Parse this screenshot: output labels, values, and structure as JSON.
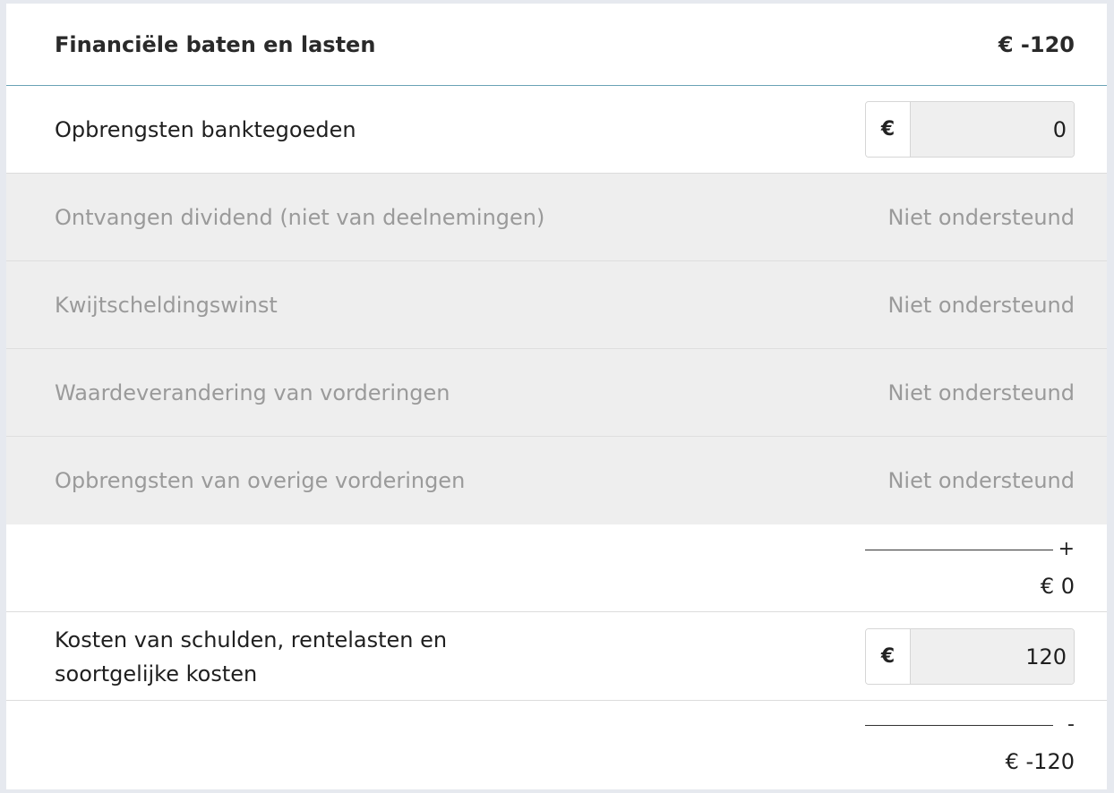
{
  "header": {
    "title": "Financiële baten en lasten",
    "total": "€ -120"
  },
  "rows": {
    "bank_income": {
      "label": "Opbrengsten banktegoeden",
      "currency": "€",
      "value": "0"
    },
    "dividend": {
      "label": "Ontvangen dividend (niet van deelnemingen)",
      "status": "Niet ondersteund"
    },
    "debt_relief": {
      "label": "Kwijtscheldingswinst",
      "status": "Niet ondersteund"
    },
    "receivables_change": {
      "label": "Waardeverandering van vorderingen",
      "status": "Niet ondersteund"
    },
    "other_receivables": {
      "label": "Opbrengsten van overige vorderingen",
      "status": "Niet ondersteund"
    },
    "subtotal_income": {
      "operator": "+",
      "value": "€ 0"
    },
    "debt_costs": {
      "label_line1": "Kosten van schulden, rentelasten en",
      "label_line2": "soortgelijke kosten",
      "currency": "€",
      "value": "120"
    },
    "subtotal_total": {
      "operator": "-",
      "value": "€ -120"
    }
  }
}
